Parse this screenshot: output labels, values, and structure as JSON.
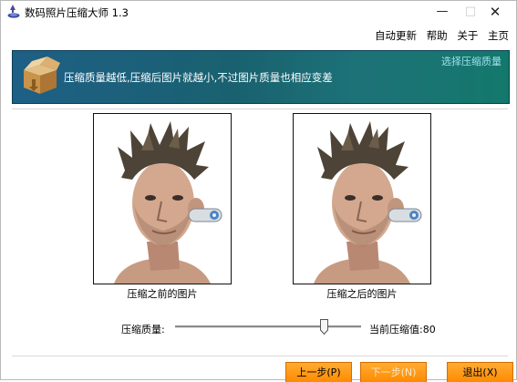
{
  "window": {
    "title": "数码照片压缩大师 1.3",
    "minimize_glyph": "—",
    "maximize_glyph": "□",
    "close_glyph": "✕"
  },
  "menu": {
    "items": [
      "自动更新",
      "帮助",
      "关于",
      "主页"
    ]
  },
  "banner": {
    "text": "压缩质量越低,压缩后图片就越小,不过图片质量也相应变差",
    "link": "选择压缩质量",
    "icon": "box-icon"
  },
  "preview": {
    "before_caption": "压缩之前的图片",
    "after_caption": "压缩之后的图片"
  },
  "quality": {
    "label": "压缩质量:",
    "value_label": "当前压缩值:80",
    "value": 80,
    "min": 0,
    "max": 100
  },
  "buttons": {
    "prev": "上一步(P)",
    "next": "下一步(N)",
    "exit": "退出(X)"
  },
  "colors": {
    "banner_start": "#1e5f86",
    "banner_end": "#13786b",
    "button_orange": "#ff9a1a"
  }
}
